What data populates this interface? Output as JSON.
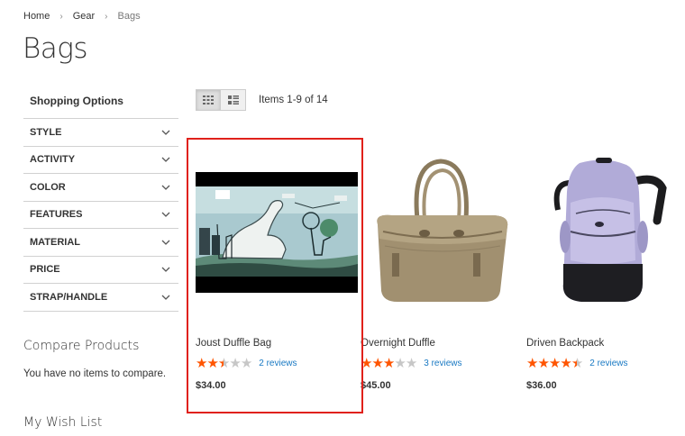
{
  "breadcrumb": {
    "home": "Home",
    "gear": "Gear",
    "current": "Bags",
    "separator": "›"
  },
  "page_title": "Bags",
  "sidebar": {
    "shopping_options": "Shopping Options",
    "filters": [
      "STYLE",
      "ACTIVITY",
      "COLOR",
      "FEATURES",
      "MATERIAL",
      "PRICE",
      "STRAP/HANDLE"
    ]
  },
  "compare": {
    "title": "Compare Products",
    "empty": "You have no items to compare."
  },
  "wishlist": {
    "title": "My Wish List"
  },
  "toolbar": {
    "amount": "Items 1-9 of 14",
    "modes": [
      "grid",
      "list"
    ],
    "active_mode": "grid"
  },
  "products": [
    {
      "name": "Joust Duffle Bag",
      "rating_stars": 2.5,
      "reviews": "2 reviews",
      "price": "$34.00",
      "image": "joust-duffle-video-thumbnail"
    },
    {
      "name": "Overnight Duffle",
      "rating_stars": 3,
      "reviews": "3 reviews",
      "price": "$45.00",
      "image": "tan-duffle-bag"
    },
    {
      "name": "Driven Backpack",
      "rating_stars": 4.5,
      "reviews": "2 reviews",
      "price": "$36.00",
      "image": "lavender-backpack"
    }
  ],
  "colors": {
    "accent_link": "#1979c3",
    "star": "#ff5501",
    "highlight": "#e0211b"
  }
}
